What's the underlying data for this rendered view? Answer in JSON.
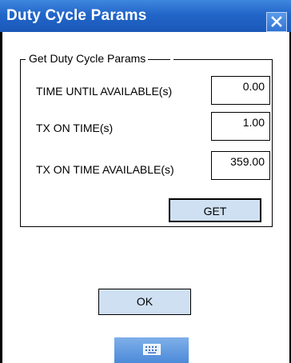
{
  "window": {
    "title": "Duty Cycle Params",
    "close_icon": "close-icon"
  },
  "group": {
    "legend": "Get Duty Cycle Params",
    "fields": [
      {
        "label": "TIME UNTIL AVAILABLE(s)",
        "value": "0.00"
      },
      {
        "label": "TX ON TIME(s)",
        "value": "1.00"
      },
      {
        "label": "TX ON TIME AVAILABLE(s)",
        "value": "359.00"
      }
    ],
    "get_label": "GET"
  },
  "ok_label": "OK",
  "keyboard_icon": "keyboard-icon"
}
